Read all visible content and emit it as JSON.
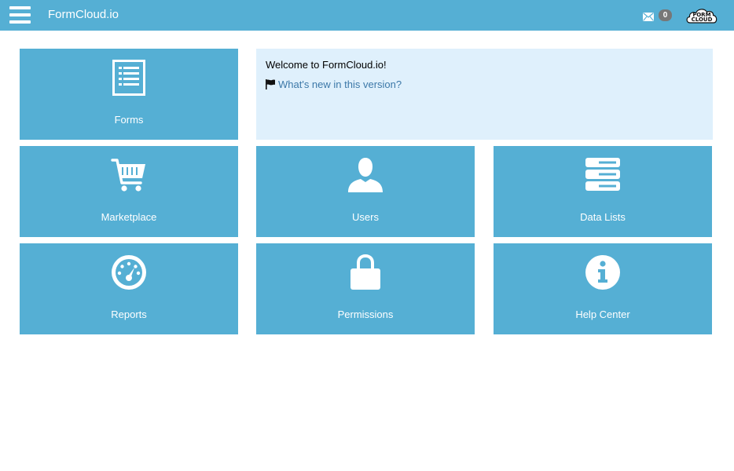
{
  "header": {
    "app_title": "FormCloud.io",
    "mail_count": "0",
    "logo_text_line1": "FORM",
    "logo_text_line2": "CLOUD"
  },
  "welcome": {
    "title": "Welcome to FormCloud.io!",
    "whats_new_link": "What's new in this version?"
  },
  "tiles": [
    {
      "label": "Forms",
      "icon": "list-icon"
    },
    {
      "label": "Marketplace",
      "icon": "cart-icon"
    },
    {
      "label": "Users",
      "icon": "user-icon"
    },
    {
      "label": "Data Lists",
      "icon": "server-icon"
    },
    {
      "label": "Reports",
      "icon": "dashboard-icon"
    },
    {
      "label": "Permissions",
      "icon": "lock-icon"
    },
    {
      "label": "Help Center",
      "icon": "info-icon"
    }
  ],
  "colors": {
    "primary": "#55afd4",
    "welcome_bg": "#dff0fc",
    "link": "#3c78a8",
    "badge": "#777777"
  }
}
